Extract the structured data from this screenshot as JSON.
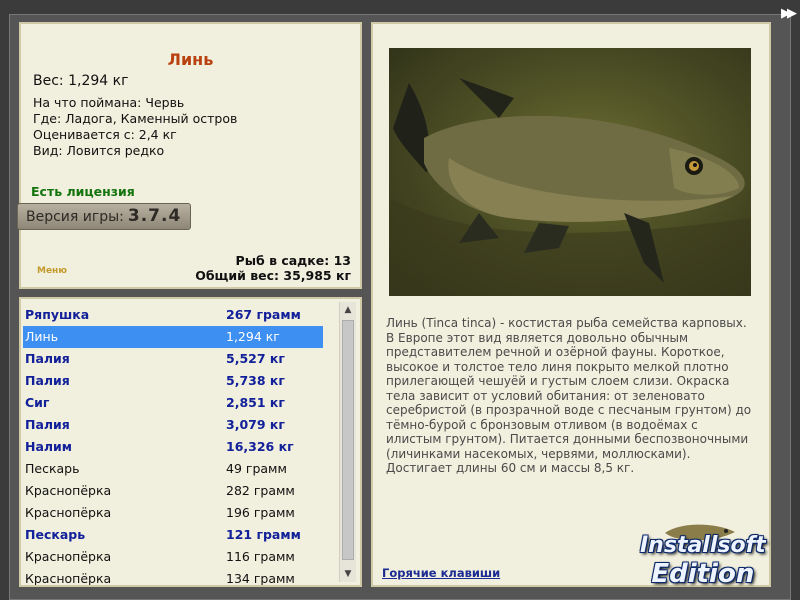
{
  "fish": {
    "title": "Линь",
    "weight": "Вес: 1,294 кг",
    "bait": "На что поймана: Червь",
    "location": "Где: Ладога, Каменный остров",
    "value": "Оценивается с: 2,4 кг",
    "rarity": "Вид: Ловится редко"
  },
  "license": "Есть лицензия",
  "version": {
    "label": "Версия игры:",
    "number": "3.7.4"
  },
  "stats": {
    "count": "Рыб в садке: 13",
    "total": "Общий вес: 35,985 кг"
  },
  "menu_label": "Меню",
  "catch_list": [
    {
      "name": "Ряпушка",
      "weight": "267 грамм",
      "bold": true
    },
    {
      "name": "Линь",
      "weight": "1,294 кг",
      "selected": true
    },
    {
      "name": "Палия",
      "weight": "5,527 кг",
      "bold": true
    },
    {
      "name": "Палия",
      "weight": "5,738 кг",
      "bold": true
    },
    {
      "name": "Сиг",
      "weight": "2,851 кг",
      "bold": true
    },
    {
      "name": "Палия",
      "weight": "3,079 кг",
      "bold": true
    },
    {
      "name": "Налим",
      "weight": "16,326 кг",
      "bold": true
    },
    {
      "name": "Пескарь",
      "weight": "49 грамм"
    },
    {
      "name": "Краснопёрка",
      "weight": "282 грамм"
    },
    {
      "name": "Краснопёрка",
      "weight": "196 грамм"
    },
    {
      "name": "Пескарь",
      "weight": "121 грамм",
      "bold": true
    },
    {
      "name": "Краснопёрка",
      "weight": "116 грамм"
    },
    {
      "name": "Краснопёрка",
      "weight": "134 грамм"
    }
  ],
  "description": "Линь (Tinca tinca) - костистая рыба семейства карповых. В Европе этот вид является довольно обычным представителем речной и озёрной фауны. Короткое, высокое и толстое тело линя покрыто мелкой плотно прилегающей чешуёй и густым слоем слизи. Окраска тела зависит от условий обитания: от зеленовато серебристой (в прозрачной воде с песчаным грунтом) до тёмно-бурой с бронзовым отливом (в водоёмах с илистым грунтом). Питается донными беспозвоночными (личинками насекомых, червями, моллюсками). Достигает длины 60 см и массы 8,5 кг.",
  "hotkeys_link": "Горячие клавиши",
  "logo": {
    "line1": "Installsoft",
    "line2": "Edition"
  },
  "colors": {
    "panel_bg": "#f1efdd",
    "title": "#b9410f",
    "license": "#14750f",
    "list_bold": "#12209a",
    "selection": "#3d8ff2",
    "link": "#1c2b94"
  },
  "icons": {
    "nav": "double-chevron-right-icon",
    "scroll_up": "arrow-up-icon",
    "scroll_down": "arrow-down-icon"
  }
}
